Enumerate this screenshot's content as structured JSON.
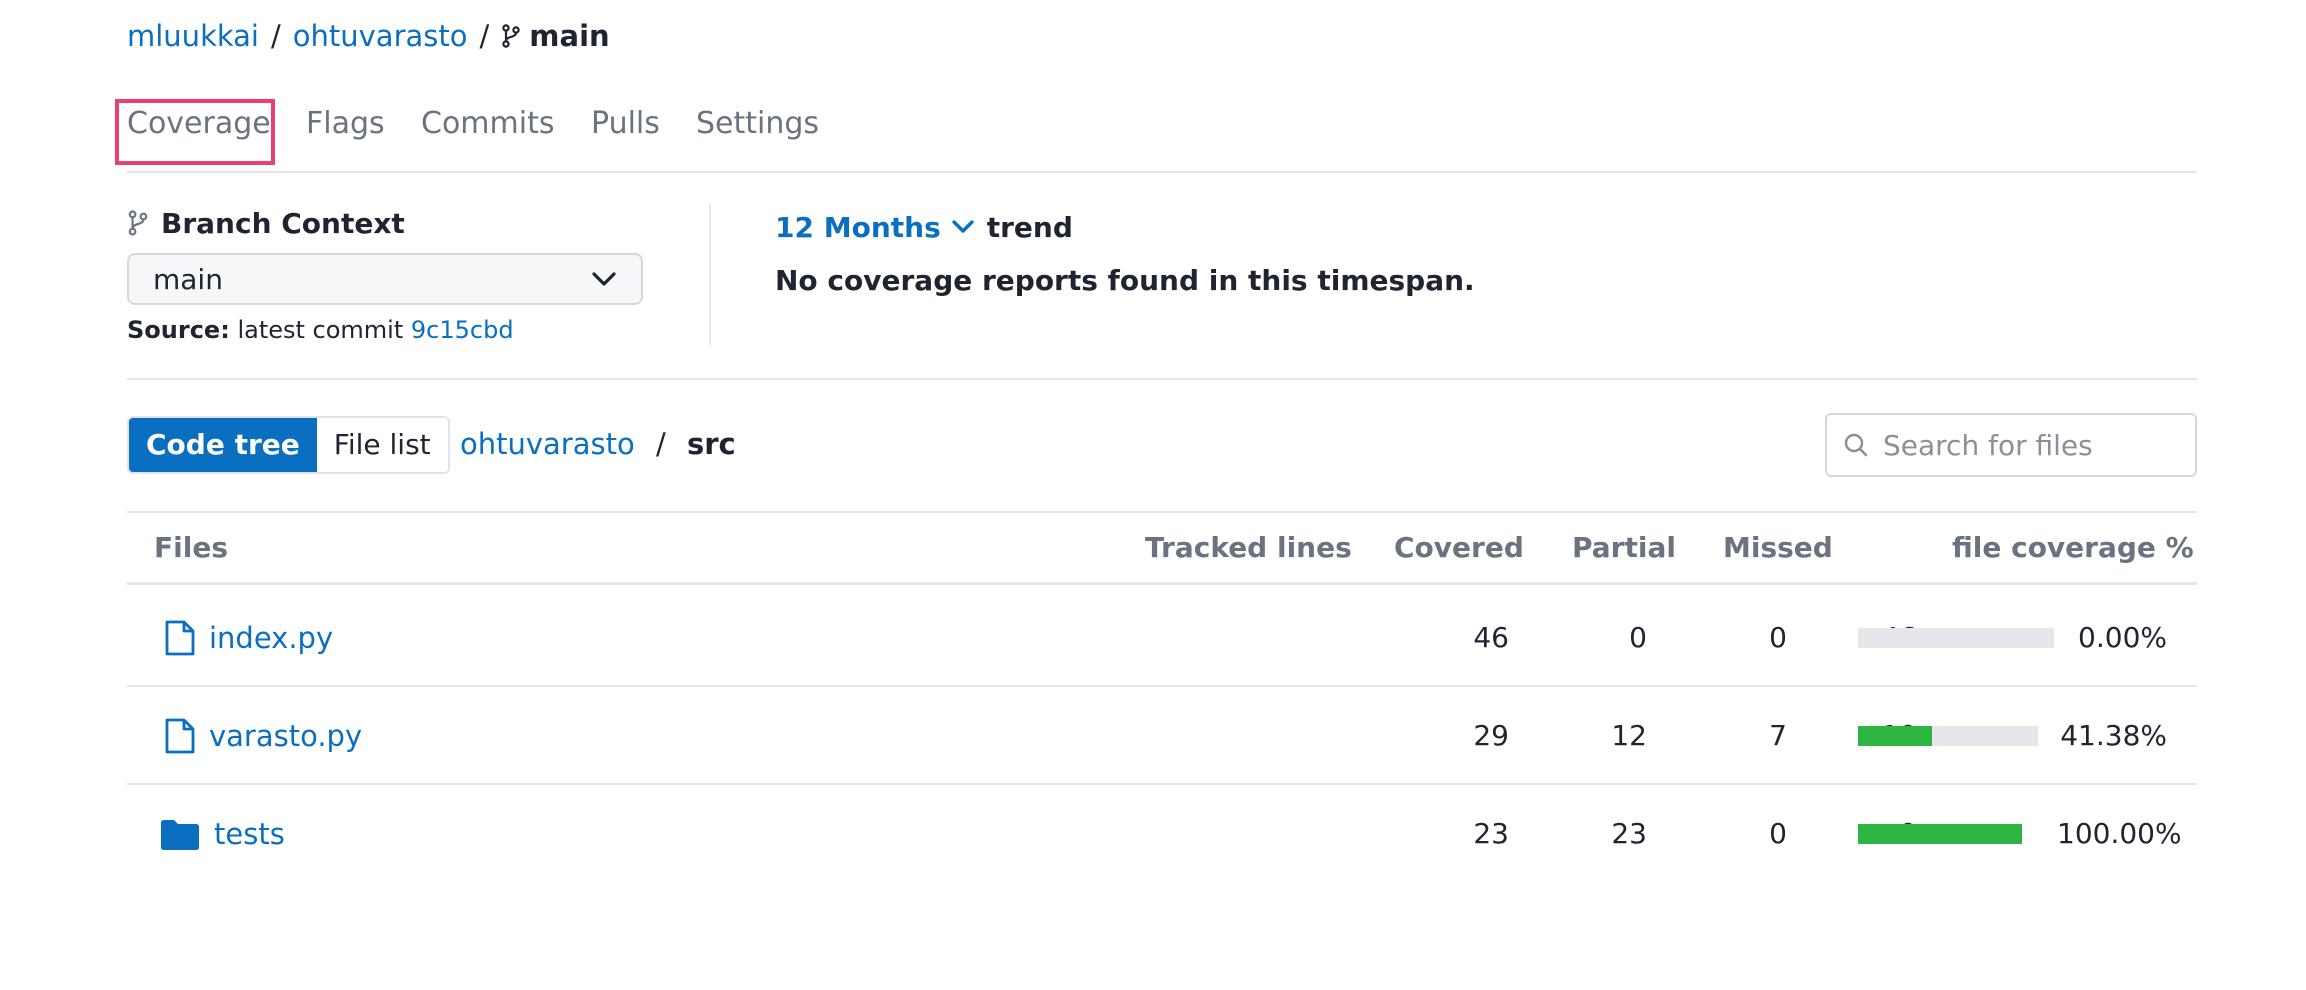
{
  "breadcrumb": {
    "owner": "mluukkai",
    "repo": "ohtuvarasto",
    "separator": "/",
    "branch": "main"
  },
  "tabs": [
    {
      "label": "Coverage",
      "active": true
    },
    {
      "label": "Flags",
      "active": false
    },
    {
      "label": "Commits",
      "active": false
    },
    {
      "label": "Pulls",
      "active": false
    },
    {
      "label": "Settings",
      "active": false
    }
  ],
  "branch_context": {
    "title": "Branch Context",
    "selected": "main",
    "source_label": "Source:",
    "source_text": "latest commit",
    "commit": "9c15cbd"
  },
  "trend": {
    "range": "12 Months",
    "label": "trend",
    "message": "No coverage reports found in this timespan."
  },
  "view": {
    "code_tree": "Code tree",
    "file_list": "File list"
  },
  "path": {
    "root": "ohtuvarasto",
    "separator": "/",
    "current": "src"
  },
  "search": {
    "placeholder": "Search for files"
  },
  "table": {
    "headers": [
      "Files",
      "Tracked lines",
      "Covered",
      "Partial",
      "Missed",
      "file coverage %"
    ],
    "rows": [
      {
        "name": "index.py",
        "kind": "file",
        "tracked": "46",
        "covered": "0",
        "partial": "0",
        "missed": "46",
        "coverage": 0.0,
        "coverage_label": "0.00%"
      },
      {
        "name": "varasto.py",
        "kind": "file",
        "tracked": "29",
        "covered": "12",
        "partial": "7",
        "missed": "10",
        "coverage": 41.38,
        "coverage_label": "41.38%"
      },
      {
        "name": "tests",
        "kind": "folder",
        "tracked": "23",
        "covered": "23",
        "partial": "0",
        "missed": "0",
        "coverage": 100.0,
        "coverage_label": "100.00%"
      }
    ]
  },
  "colors": {
    "link": "#0b6fc1",
    "coverage_fill": "#2db642",
    "coverage_track": "#e5e7eb",
    "active_tab_outline": "#ea3f73",
    "toggle_active": "#0b6fc1"
  },
  "icons": {
    "branch": "git-branch-icon",
    "chevron": "chevron-down-icon",
    "search": "search-icon",
    "file": "file-icon",
    "folder": "folder-icon"
  }
}
